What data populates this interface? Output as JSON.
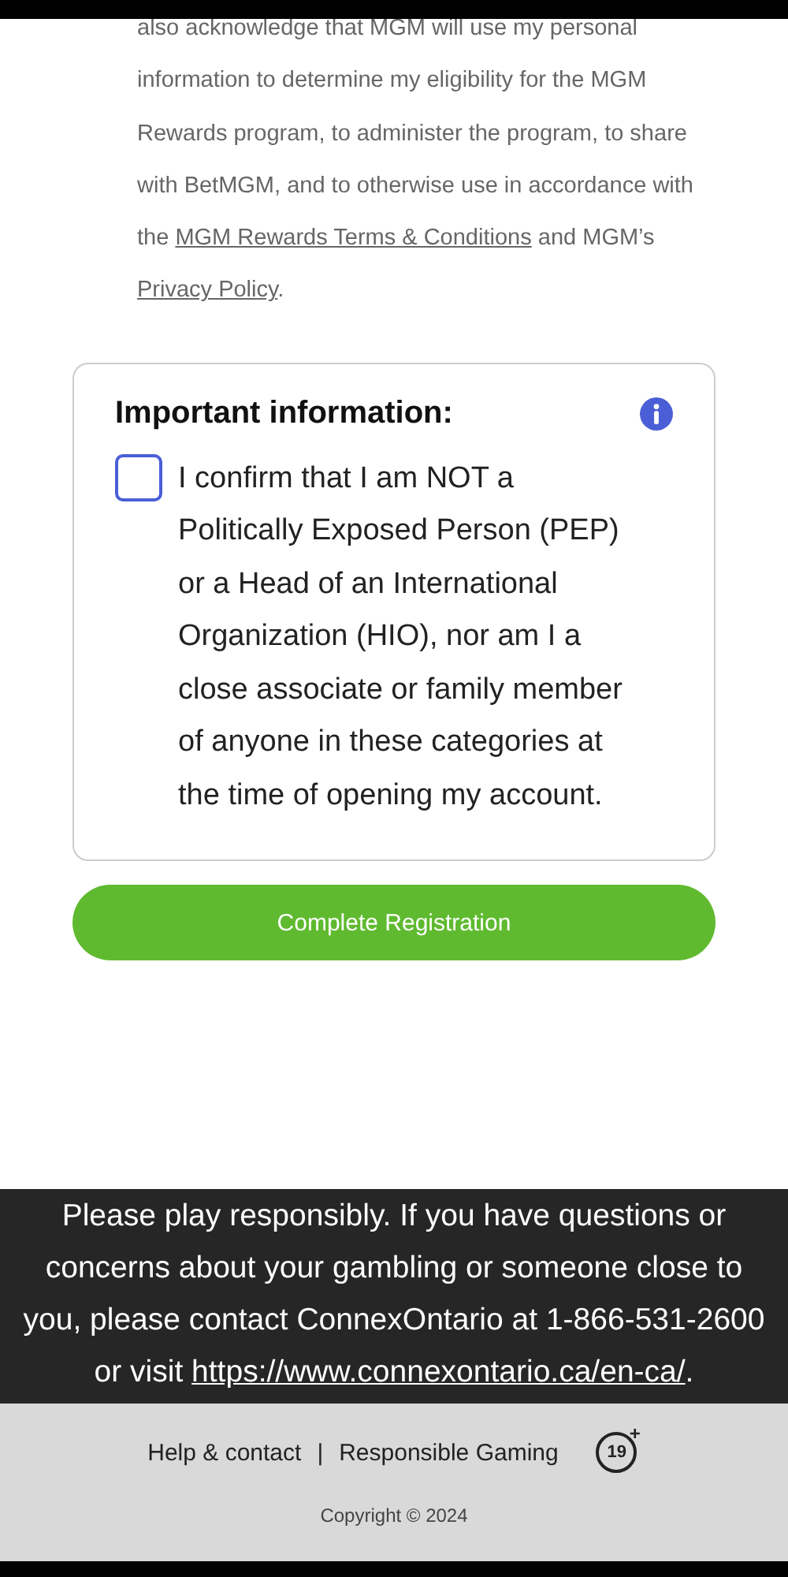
{
  "consent": {
    "parts": [
      {
        "kind": "text",
        "text": "also acknowledge that MGM will use my personal information to determine my eligibility for the MGM Rewards program, to administer the program, to share with BetMGM, and to otherwise use in accordance with the "
      },
      {
        "kind": "link",
        "text": "MGM Rewards Terms & Conditions"
      },
      {
        "kind": "text",
        "text": " and MGM’s "
      },
      {
        "kind": "link",
        "text": "Privacy Policy"
      },
      {
        "kind": "text",
        "text": "."
      }
    ]
  },
  "important": {
    "title": "Important information:",
    "checkbox": {
      "checked": false,
      "label": "I confirm that I am NOT a Politically Exposed Person (PEP) or a Head of an International Organization (HIO), nor am I a close associate or family member of anyone in these categories at the time of opening my account."
    }
  },
  "submit_button": "Complete Registration",
  "banner": {
    "parts": [
      {
        "kind": "text",
        "text": "Please play responsibly. If you have questions or concerns about your gambling or someone close to you, please contact ConnexOntario at 1-866-531-2600 or visit "
      },
      {
        "kind": "link",
        "text": "https://www.connexontario.ca/en-ca/"
      },
      {
        "kind": "text",
        "text": "."
      }
    ]
  },
  "footer": {
    "links": [
      "Help & contact",
      "Responsible Gaming"
    ],
    "separator": "|",
    "age_badge": {
      "number": "19",
      "plus": "+"
    },
    "copyright": "Copyright © 2024"
  }
}
